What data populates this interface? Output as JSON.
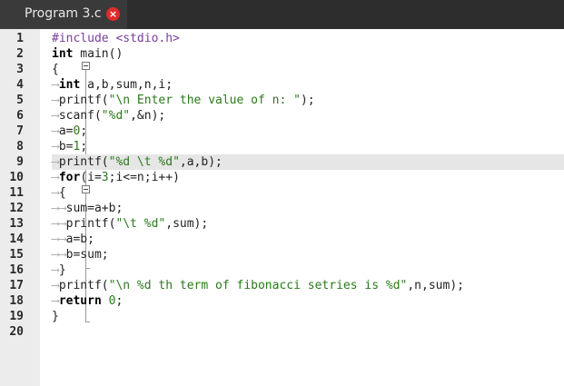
{
  "tab": {
    "title": "Program 3.c",
    "close_glyph": "×"
  },
  "colors": {
    "keyword": "#000000",
    "preprocessor": "#7a3e9d",
    "string": "#2a7a1a",
    "close_button": "#e02b2b"
  },
  "editor": {
    "current_line": 9,
    "lines": [
      {
        "n": "1",
        "tokens": [
          {
            "t": "pp",
            "v": "#include <stdio.h>"
          }
        ]
      },
      {
        "n": "2",
        "tokens": [
          {
            "t": "kw",
            "v": "int"
          },
          {
            "t": "plain",
            "v": " main()"
          }
        ]
      },
      {
        "n": "3",
        "tokens": [
          {
            "t": "plain",
            "v": "{"
          }
        ]
      },
      {
        "n": "4",
        "tokens": [
          {
            "t": "tab",
            "v": "⟶"
          },
          {
            "t": "kw",
            "v": "int"
          },
          {
            "t": "plain",
            "v": " a,b,sum,n,i;"
          }
        ]
      },
      {
        "n": "5",
        "tokens": [
          {
            "t": "tab",
            "v": "⟶"
          },
          {
            "t": "plain",
            "v": "printf("
          },
          {
            "t": "str",
            "v": "\"\\n Enter the value of n: \""
          },
          {
            "t": "plain",
            "v": ");"
          }
        ]
      },
      {
        "n": "6",
        "tokens": [
          {
            "t": "tab",
            "v": "⟶"
          },
          {
            "t": "plain",
            "v": "scanf("
          },
          {
            "t": "str",
            "v": "\"%d\""
          },
          {
            "t": "plain",
            "v": ",&n);"
          }
        ]
      },
      {
        "n": "7",
        "tokens": [
          {
            "t": "tab",
            "v": "⟶"
          },
          {
            "t": "plain",
            "v": "a="
          },
          {
            "t": "num",
            "v": "0"
          },
          {
            "t": "plain",
            "v": ";"
          }
        ]
      },
      {
        "n": "8",
        "tokens": [
          {
            "t": "tab",
            "v": "⟶"
          },
          {
            "t": "plain",
            "v": "b="
          },
          {
            "t": "num",
            "v": "1"
          },
          {
            "t": "plain",
            "v": ";"
          }
        ]
      },
      {
        "n": "9",
        "tokens": [
          {
            "t": "tab",
            "v": "⟶"
          },
          {
            "t": "plain",
            "v": "printf("
          },
          {
            "t": "str",
            "v": "\"%d \\t %d\""
          },
          {
            "t": "plain",
            "v": ",a,b);"
          }
        ]
      },
      {
        "n": "10",
        "tokens": [
          {
            "t": "tab",
            "v": "⟶"
          },
          {
            "t": "kw",
            "v": "for"
          },
          {
            "t": "plain",
            "v": "(i="
          },
          {
            "t": "num",
            "v": "3"
          },
          {
            "t": "plain",
            "v": ";i<=n;i++)"
          }
        ]
      },
      {
        "n": "11",
        "tokens": [
          {
            "t": "tab",
            "v": "⟶"
          },
          {
            "t": "plain",
            "v": "{"
          }
        ]
      },
      {
        "n": "12",
        "tokens": [
          {
            "t": "tab",
            "v": "⟶⟶"
          },
          {
            "t": "plain",
            "v": "sum=a+b;"
          }
        ]
      },
      {
        "n": "13",
        "tokens": [
          {
            "t": "tab",
            "v": "⟶⟶"
          },
          {
            "t": "plain",
            "v": "printf("
          },
          {
            "t": "str",
            "v": "\"\\t %d\""
          },
          {
            "t": "plain",
            "v": ",sum);"
          }
        ]
      },
      {
        "n": "14",
        "tokens": [
          {
            "t": "tab",
            "v": "⟶⟶"
          },
          {
            "t": "plain",
            "v": "a=b;"
          }
        ]
      },
      {
        "n": "15",
        "tokens": [
          {
            "t": "tab",
            "v": "⟶⟶"
          },
          {
            "t": "plain",
            "v": "b=sum;"
          }
        ]
      },
      {
        "n": "16",
        "tokens": [
          {
            "t": "tab",
            "v": "⟶"
          },
          {
            "t": "plain",
            "v": "}"
          }
        ]
      },
      {
        "n": "17",
        "tokens": [
          {
            "t": "tab",
            "v": "⟶"
          },
          {
            "t": "plain",
            "v": "printf("
          },
          {
            "t": "str",
            "v": "\"\\n %d th term of fibonacci setries is %d\""
          },
          {
            "t": "plain",
            "v": ",n,sum);"
          }
        ]
      },
      {
        "n": "18",
        "tokens": [
          {
            "t": "tab",
            "v": "⟶"
          },
          {
            "t": "kw",
            "v": "return"
          },
          {
            "t": "plain",
            "v": " "
          },
          {
            "t": "num",
            "v": "0"
          },
          {
            "t": "plain",
            "v": ";"
          }
        ]
      },
      {
        "n": "19",
        "tokens": [
          {
            "t": "plain",
            "v": "}"
          }
        ]
      },
      {
        "n": "20",
        "tokens": []
      }
    ]
  }
}
